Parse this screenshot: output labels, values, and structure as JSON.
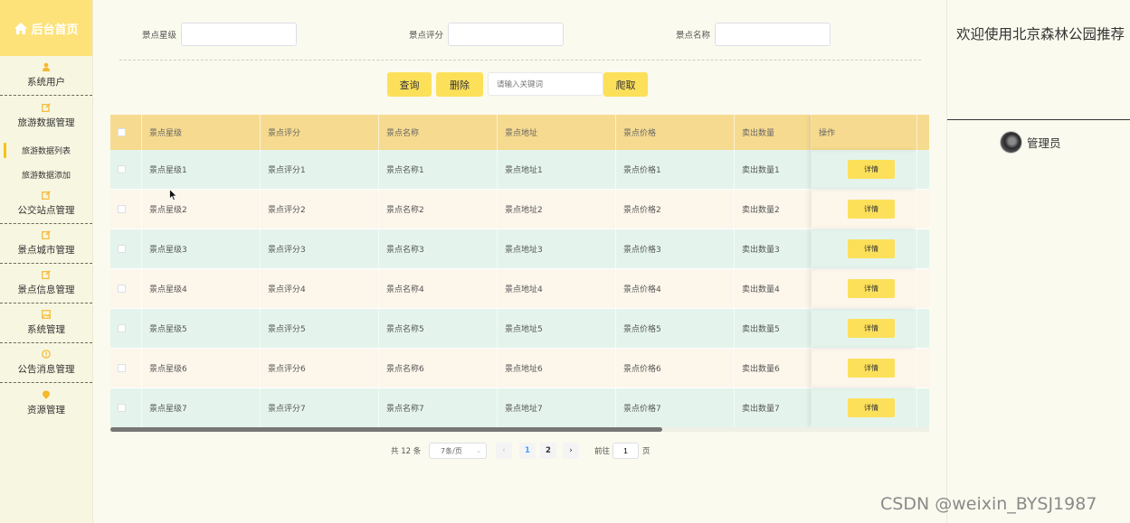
{
  "sidebar": {
    "brand_title": "后台首页",
    "items": [
      {
        "label": "系统用户",
        "icon": "user-icon"
      },
      {
        "label": "旅游数据管理",
        "icon": "edit-icon"
      },
      {
        "label": "公交站点管理",
        "icon": "edit-icon"
      },
      {
        "label": "景点城市管理",
        "icon": "edit-icon"
      },
      {
        "label": "景点信息管理",
        "icon": "edit-icon"
      },
      {
        "label": "系统管理",
        "icon": "image-icon"
      },
      {
        "label": "公告消息管理",
        "icon": "warning-icon"
      },
      {
        "label": "资源管理",
        "icon": "location-icon"
      }
    ],
    "sub_items": [
      "旅游数据列表",
      "旅游数据添加"
    ]
  },
  "header": {
    "welcome": "欢迎使用北京森林公园推荐",
    "admin_name": "管理员"
  },
  "search": {
    "field1_label": "景点星级",
    "field2_label": "景点评分",
    "field3_label": "景点名称",
    "query_button": "查询",
    "delete_button": "删除",
    "keyword_placeholder": "请输入关键词",
    "crawl_button": "爬取"
  },
  "table": {
    "columns": [
      "景点星级",
      "景点评分",
      "景点名称",
      "景点地址",
      "景点价格",
      "卖出数量",
      "操作"
    ],
    "detail_label": "详情",
    "rows": [
      [
        "景点星级1",
        "景点评分1",
        "景点名称1",
        "景点地址1",
        "景点价格1",
        "卖出数量1"
      ],
      [
        "景点星级2",
        "景点评分2",
        "景点名称2",
        "景点地址2",
        "景点价格2",
        "卖出数量2"
      ],
      [
        "景点星级3",
        "景点评分3",
        "景点名称3",
        "景点地址3",
        "景点价格3",
        "卖出数量3"
      ],
      [
        "景点星级4",
        "景点评分4",
        "景点名称4",
        "景点地址4",
        "景点价格4",
        "卖出数量4"
      ],
      [
        "景点星级5",
        "景点评分5",
        "景点名称5",
        "景点地址5",
        "景点价格5",
        "卖出数量5"
      ],
      [
        "景点星级6",
        "景点评分6",
        "景点名称6",
        "景点地址6",
        "景点价格6",
        "卖出数量6"
      ],
      [
        "景点星级7",
        "景点评分7",
        "景点名称7",
        "景点地址7",
        "景点价格7",
        "卖出数量7"
      ]
    ]
  },
  "pagination": {
    "total_label": "共 12 条",
    "page_size": "7条/页",
    "pages": [
      "1",
      "2"
    ],
    "current_page": "1",
    "goto_label": "前往",
    "goto_value": "1",
    "page_unit": "页",
    "prev_icon": "chevron-left-icon",
    "next_icon": "chevron-right-icon"
  },
  "watermark": "CSDN @weixin_BYSJ1987",
  "colors": {
    "accent": "#fde05a",
    "brand_bg": "#fde27a",
    "header_bg": "#f6da8f",
    "row_even": "#e4f4ec",
    "row_odd": "#fcf6eb",
    "page_active": "#409eff"
  }
}
